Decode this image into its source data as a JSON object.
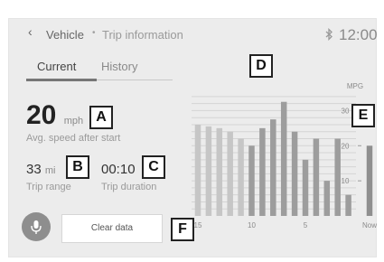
{
  "header": {
    "back_icon": "chevron-left-icon",
    "breadcrumb_parent": "Vehicle",
    "breadcrumb_separator": "•",
    "breadcrumb_current": "Trip information",
    "bluetooth_icon": "bluetooth-icon",
    "clock": "12:00"
  },
  "tabs": [
    {
      "label": "Current",
      "selected": true
    },
    {
      "label": "History",
      "selected": false
    }
  ],
  "stats": {
    "avg_speed_value": "20",
    "avg_speed_unit": "mph",
    "avg_speed_caption": "Avg. speed after start",
    "trip_range_value": "33",
    "trip_range_unit": "mi",
    "trip_range_caption": "Trip range",
    "trip_duration_value": "00:10",
    "trip_duration_caption": "Trip duration"
  },
  "actions": {
    "mic_icon": "microphone-icon",
    "clear_label": "Clear data"
  },
  "callouts": {
    "A": "A",
    "B": "B",
    "C": "C",
    "D": "D",
    "E": "E",
    "F": "F"
  },
  "colors": {
    "frame_bg": "#ececec",
    "bar_past": "#c6c6c6",
    "bar_recent": "#9d9d9d",
    "bar_now": "#8f8f8f",
    "text_dark": "#222222"
  },
  "chart_data": {
    "type": "bar",
    "ylabel": "MPG",
    "ylim": [
      0,
      35
    ],
    "yticks": [
      10,
      20,
      30
    ],
    "xtick_labels": [
      "15",
      "10",
      "5",
      "Now"
    ],
    "grid": true,
    "x": [
      15,
      14,
      13,
      12,
      11,
      10,
      9,
      8,
      7,
      6,
      5,
      4,
      3,
      2,
      1,
      "Now"
    ],
    "values": [
      26,
      25.5,
      25,
      24,
      22,
      20,
      25,
      27.5,
      32.5,
      24,
      16,
      22,
      10,
      22,
      6,
      20
    ],
    "recent_from_index": 5
  }
}
